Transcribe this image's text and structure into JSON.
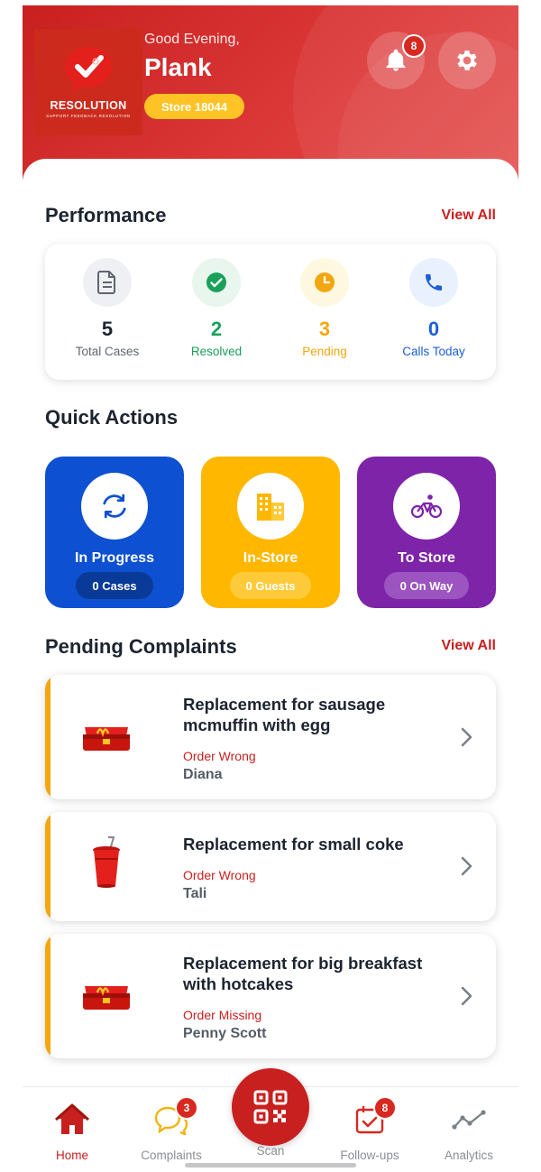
{
  "header": {
    "greeting": "Good Evening,",
    "user_name": "Plank",
    "store_label": "Store 18044",
    "notification_count": "8",
    "logo": {
      "name": "RESOLUTION",
      "tagline": "SUPPORT  FEEDBACK  RESOLUTION"
    }
  },
  "performance": {
    "title": "Performance",
    "view_all": "View All",
    "stats": [
      {
        "value": "5",
        "label": "Total Cases",
        "icon": "document-icon"
      },
      {
        "value": "2",
        "label": "Resolved",
        "icon": "check-circle-icon"
      },
      {
        "value": "3",
        "label": "Pending",
        "icon": "clock-icon"
      },
      {
        "value": "0",
        "label": "Calls Today",
        "icon": "phone-icon"
      }
    ]
  },
  "quick_actions": {
    "title": "Quick Actions",
    "items": [
      {
        "title": "In Progress",
        "pill": "0 Cases",
        "icon": "refresh-icon"
      },
      {
        "title": "In-Store",
        "pill": "0 Guests",
        "icon": "building-icon"
      },
      {
        "title": "To Store",
        "pill": "0 On Way",
        "icon": "bicycle-icon"
      }
    ]
  },
  "pending_complaints": {
    "title": "Pending Complaints",
    "view_all": "View All",
    "items": [
      {
        "title": "Replacement for sausage mcmuffin with egg",
        "reason": "Order Wrong",
        "customer": "Diana",
        "thumb": "meal-box-icon"
      },
      {
        "title": "Replacement for small coke",
        "reason": "Order Wrong",
        "customer": "Tali",
        "thumb": "drink-cup-icon"
      },
      {
        "title": "Replacement for big breakfast with hotcakes",
        "reason": "Order Missing",
        "customer": "Penny Scott",
        "thumb": "meal-box-icon"
      }
    ]
  },
  "bottom_nav": {
    "home": "Home",
    "complaints": "Complaints",
    "complaints_badge": "3",
    "scan": "Scan",
    "followups": "Follow-ups",
    "followups_badge": "8",
    "analytics": "Analytics"
  },
  "colors": {
    "brand_red": "#c8201f",
    "resolved_green": "#1aa05a",
    "pending_amber": "#f3a60e",
    "calls_blue": "#1c5fd6",
    "in_progress_blue": "#0d50d1",
    "in_store_yellow": "#ffb700",
    "to_store_purple": "#7e24a8"
  }
}
